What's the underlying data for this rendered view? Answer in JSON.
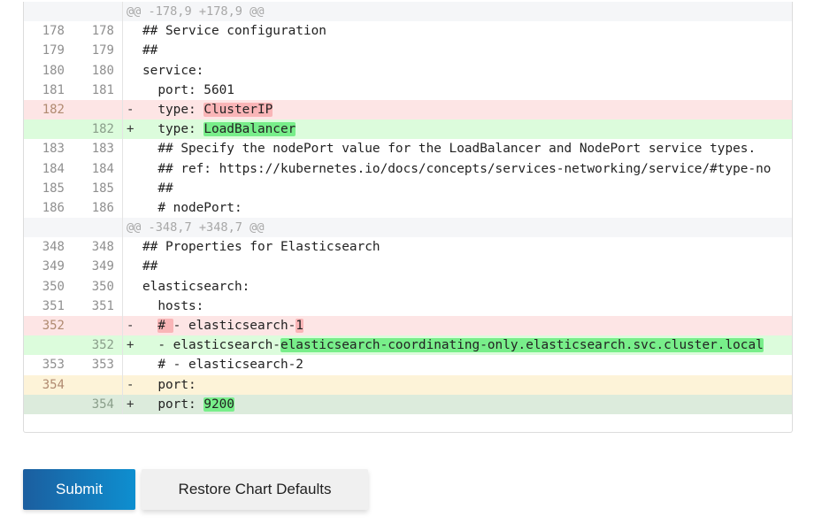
{
  "diff": {
    "rows": [
      {
        "type": "hunk",
        "old": "",
        "new": "",
        "marker": "",
        "segments": [
          {
            "t": "@@ -178,9 +178,9 @@"
          }
        ]
      },
      {
        "type": "ctx",
        "old": "178",
        "new": "178",
        "marker": "",
        "segments": [
          {
            "t": "## Service configuration"
          }
        ]
      },
      {
        "type": "ctx",
        "old": "179",
        "new": "179",
        "marker": "",
        "segments": [
          {
            "t": "##"
          }
        ]
      },
      {
        "type": "ctx",
        "old": "180",
        "new": "180",
        "marker": "",
        "segments": [
          {
            "t": "service:"
          }
        ]
      },
      {
        "type": "ctx",
        "old": "181",
        "new": "181",
        "marker": "",
        "segments": [
          {
            "t": "  port: 5601"
          }
        ]
      },
      {
        "type": "del",
        "old": "182",
        "new": "",
        "marker": "-",
        "segments": [
          {
            "t": "  type: "
          },
          {
            "t": "ClusterIP",
            "hl": true
          }
        ]
      },
      {
        "type": "add",
        "old": "",
        "new": "182",
        "marker": "+",
        "segments": [
          {
            "t": "  type: "
          },
          {
            "t": "LoadBalancer",
            "hl": true
          }
        ]
      },
      {
        "type": "ctx",
        "old": "183",
        "new": "183",
        "marker": "",
        "segments": [
          {
            "t": "  ## Specify the nodePort value for the LoadBalancer and NodePort service types."
          }
        ]
      },
      {
        "type": "ctx",
        "old": "184",
        "new": "184",
        "marker": "",
        "segments": [
          {
            "t": "  ## ref: https://kubernetes.io/docs/concepts/services-networking/service/#type-no"
          }
        ]
      },
      {
        "type": "ctx",
        "old": "185",
        "new": "185",
        "marker": "",
        "segments": [
          {
            "t": "  ##"
          }
        ]
      },
      {
        "type": "ctx",
        "old": "186",
        "new": "186",
        "marker": "",
        "segments": [
          {
            "t": "  # nodePort:"
          }
        ]
      },
      {
        "type": "hunk",
        "old": "",
        "new": "",
        "marker": "",
        "segments": [
          {
            "t": "@@ -348,7 +348,7 @@"
          }
        ]
      },
      {
        "type": "ctx",
        "old": "348",
        "new": "348",
        "marker": "",
        "segments": [
          {
            "t": "## Properties for Elasticsearch"
          }
        ]
      },
      {
        "type": "ctx",
        "old": "349",
        "new": "349",
        "marker": "",
        "segments": [
          {
            "t": "##"
          }
        ]
      },
      {
        "type": "ctx",
        "old": "350",
        "new": "350",
        "marker": "",
        "segments": [
          {
            "t": "elasticsearch:"
          }
        ]
      },
      {
        "type": "ctx",
        "old": "351",
        "new": "351",
        "marker": "",
        "segments": [
          {
            "t": "  hosts:"
          }
        ]
      },
      {
        "type": "del",
        "old": "352",
        "new": "",
        "marker": "-",
        "segments": [
          {
            "t": "  "
          },
          {
            "t": "# ",
            "hl": true
          },
          {
            "t": "- elasticsearch-"
          },
          {
            "t": "1",
            "hl": true
          }
        ]
      },
      {
        "type": "add",
        "old": "",
        "new": "352",
        "marker": "+",
        "segments": [
          {
            "t": "  - elasticsearch-"
          },
          {
            "t": "elasticsearch-coordinating-only.elasticsearch.svc.cluster.local",
            "hl": true
          }
        ]
      },
      {
        "type": "ctx",
        "old": "353",
        "new": "353",
        "marker": "",
        "segments": [
          {
            "t": "  # - elasticsearch-2"
          }
        ]
      },
      {
        "type": "modold",
        "old": "354",
        "new": "",
        "marker": "-",
        "segments": [
          {
            "t": "  port:"
          }
        ]
      },
      {
        "type": "modnew",
        "old": "",
        "new": "354",
        "marker": "+",
        "segments": [
          {
            "t": "  port: "
          },
          {
            "t": "9200",
            "hl": true
          }
        ]
      }
    ]
  },
  "actions": {
    "submit_label": "Submit",
    "restore_label": "Restore Chart Defaults"
  },
  "colors": {
    "deleted_bg": "#fde5e5",
    "added_bg": "#dcfcdc",
    "deleted_highlight": "#f9b5b7",
    "added_highlight": "#78ee8a",
    "submit_gradient_start": "#1b5e9f",
    "submit_gradient_end": "#0e8fd0"
  }
}
